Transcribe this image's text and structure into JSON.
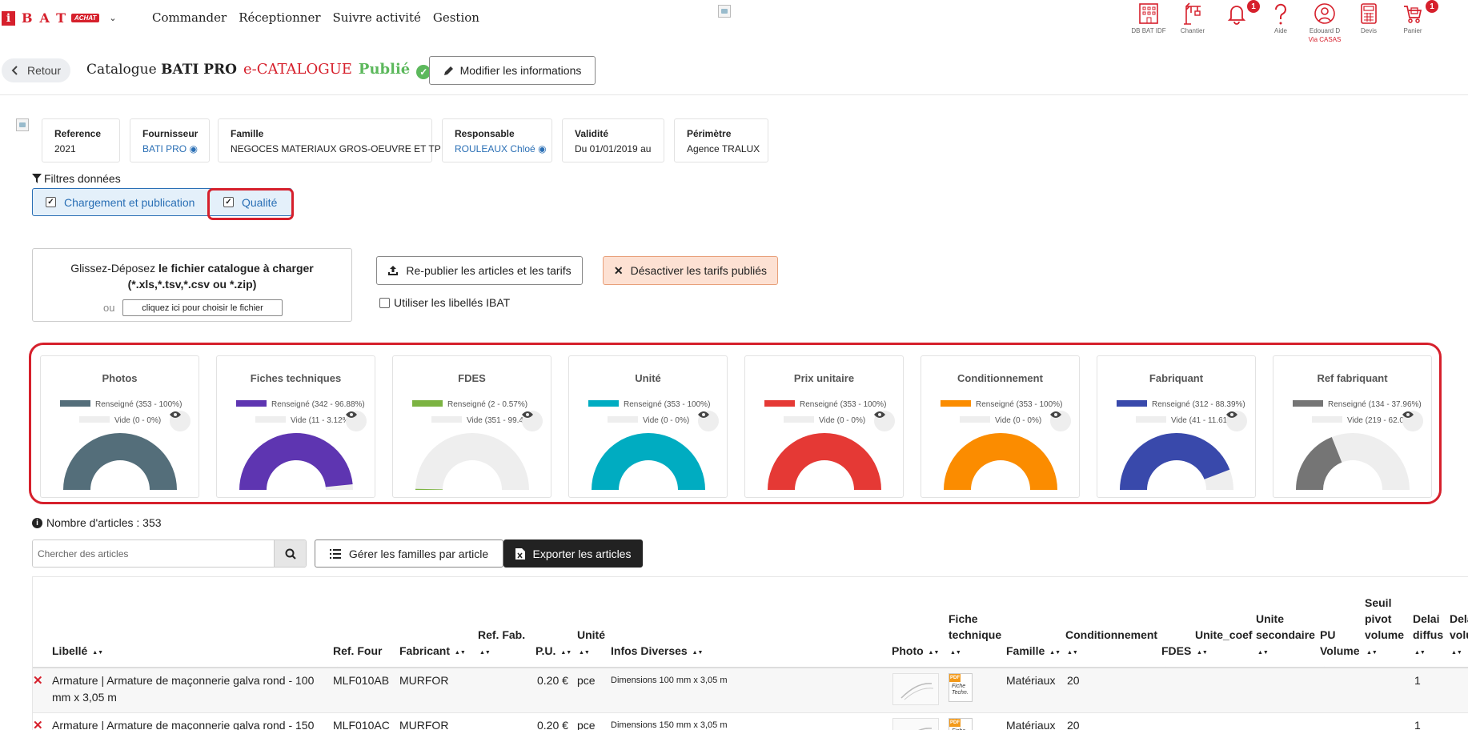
{
  "nav": {
    "logo_letter": "i",
    "logo_text": "BAT",
    "logo_badge": "ACHAT",
    "menu": [
      "Commander",
      "Réceptionner",
      "Suivre activité",
      "Gestion"
    ],
    "tools": [
      {
        "label": "DB BAT IDF",
        "icon": "building-icon"
      },
      {
        "label": "Chantier",
        "icon": "crane-icon"
      },
      {
        "label": "",
        "icon": "bell-icon",
        "badge": "1"
      },
      {
        "label": "Aide",
        "icon": "question-icon"
      },
      {
        "label": "Edouard D",
        "label2": "Via CASAS",
        "icon": "user-icon"
      },
      {
        "label": "Devis",
        "icon": "calculator-icon"
      },
      {
        "label": "Panier",
        "icon": "cart-icon",
        "badge": "1"
      }
    ]
  },
  "header": {
    "back_label": "Retour",
    "title_prefix": "Catalogue",
    "title_name": "BATI PRO",
    "title_type": "e-CATALOGUE",
    "status": "Publié",
    "edit_label": "Modifier les informations"
  },
  "info_cards": [
    {
      "label": "Reference",
      "value": "2021"
    },
    {
      "label": "Fournisseur",
      "value": "BATI PRO"
    },
    {
      "label": "Famille",
      "value": "NEGOCES MATERIAUX GROS-OEUVRE ET TP"
    },
    {
      "label": "Responsable",
      "value": "ROULEAUX Chloé"
    },
    {
      "label": "Validité",
      "value": "Du 01/01/2019 au"
    },
    {
      "label": "Périmètre",
      "value": "Agence TRALUX"
    }
  ],
  "filters": {
    "title": "Filtres données",
    "options": [
      {
        "label": "Chargement et publication",
        "checked": true
      },
      {
        "label": "Qualité",
        "checked": true
      }
    ]
  },
  "upload": {
    "line1_prefix": "Glissez-Déposez",
    "line1_bold": "le fichier catalogue à charger",
    "line2": "(*.xls,*.tsv,*.csv ou *.zip)",
    "or": "ou",
    "pick_label": "cliquez ici pour choisir le fichier"
  },
  "actions": {
    "republish": "Re-publier les articles et les tarifs",
    "deactivate": "Désactiver les tarifs publiés",
    "use_ibat_labels": "Utiliser les libellés IBAT"
  },
  "charts": [
    {
      "title": "Photos",
      "color": "#546e7a",
      "filled_label": "Renseigné (353 - 100%)",
      "empty_label": "Vide (0 - 0%)",
      "filled_fraction": 1.0
    },
    {
      "title": "Fiches techniques",
      "color": "#5e35b1",
      "filled_label": "Renseigné (342 - 96.88%)",
      "empty_label": "Vide (11 - 3.12%)",
      "filled_fraction": 0.9688
    },
    {
      "title": "FDES",
      "color": "#7cb342",
      "filled_label": "Renseigné (2 - 0.57%)",
      "empty_label": "Vide (351 - 99.43%)",
      "filled_fraction": 0.0057
    },
    {
      "title": "Unité",
      "color": "#00acc1",
      "filled_label": "Renseigné (353 - 100%)",
      "empty_label": "Vide (0 - 0%)",
      "filled_fraction": 1.0
    },
    {
      "title": "Prix unitaire",
      "color": "#e53935",
      "filled_label": "Renseigné (353 - 100%)",
      "empty_label": "Vide (0 - 0%)",
      "filled_fraction": 1.0
    },
    {
      "title": "Conditionnement",
      "color": "#fb8c00",
      "filled_label": "Renseigné (353 - 100%)",
      "empty_label": "Vide (0 - 0%)",
      "filled_fraction": 1.0
    },
    {
      "title": "Fabriquant",
      "color": "#3949ab",
      "filled_label": "Renseigné (312 - 88.39%)",
      "empty_label": "Vide (41 - 11.61%)",
      "filled_fraction": 0.8839
    },
    {
      "title": "Ref fabriquant",
      "color": "#757575",
      "filled_label": "Renseigné (134 - 37.96%)",
      "empty_label": "Vide (219 - 62.04%)",
      "filled_fraction": 0.3796
    }
  ],
  "articles": {
    "count_label": "Nombre d'articles : 353",
    "search_placeholder": "Chercher des articles",
    "manage_families": "Gérer les familles par article",
    "export": "Exporter les articles"
  },
  "table": {
    "columns": [
      "Libellé",
      "Ref. Four",
      "Fabricant",
      "Ref. Fab.",
      "P.U.",
      "Unité",
      "Infos Diverses",
      "Photo",
      "Fiche technique",
      "Famille",
      "Conditionnement",
      "FDES",
      "Unite_coef",
      "Unite secondaire",
      "PU Volume",
      "Seuil pivot volume",
      "Delai diffus",
      "Delai volu"
    ],
    "rows": [
      {
        "libelle": "Armature | Armature de maçonnerie galva rond - 100 mm x 3,05 m",
        "ref_four": "MLF010AB",
        "fabricant": "MURFOR",
        "pu": "0.20 €",
        "unite": "pce",
        "infos": "Dimensions 100 mm x 3,05 m",
        "fiche_text": "Fiche Techn.",
        "famille": "Matériaux",
        "conditionnement": "20",
        "delai": "1"
      },
      {
        "libelle": "Armature | Armature de maçonnerie galva rond - 150",
        "ref_four": "MLF010AC",
        "fabricant": "MURFOR",
        "pu": "0.20 €",
        "unite": "pce",
        "infos": "Dimensions 150 mm x 3,05 m",
        "fiche_text": "Fiche Techn.",
        "famille": "Matériaux",
        "conditionnement": "20",
        "delai": "1"
      }
    ]
  }
}
